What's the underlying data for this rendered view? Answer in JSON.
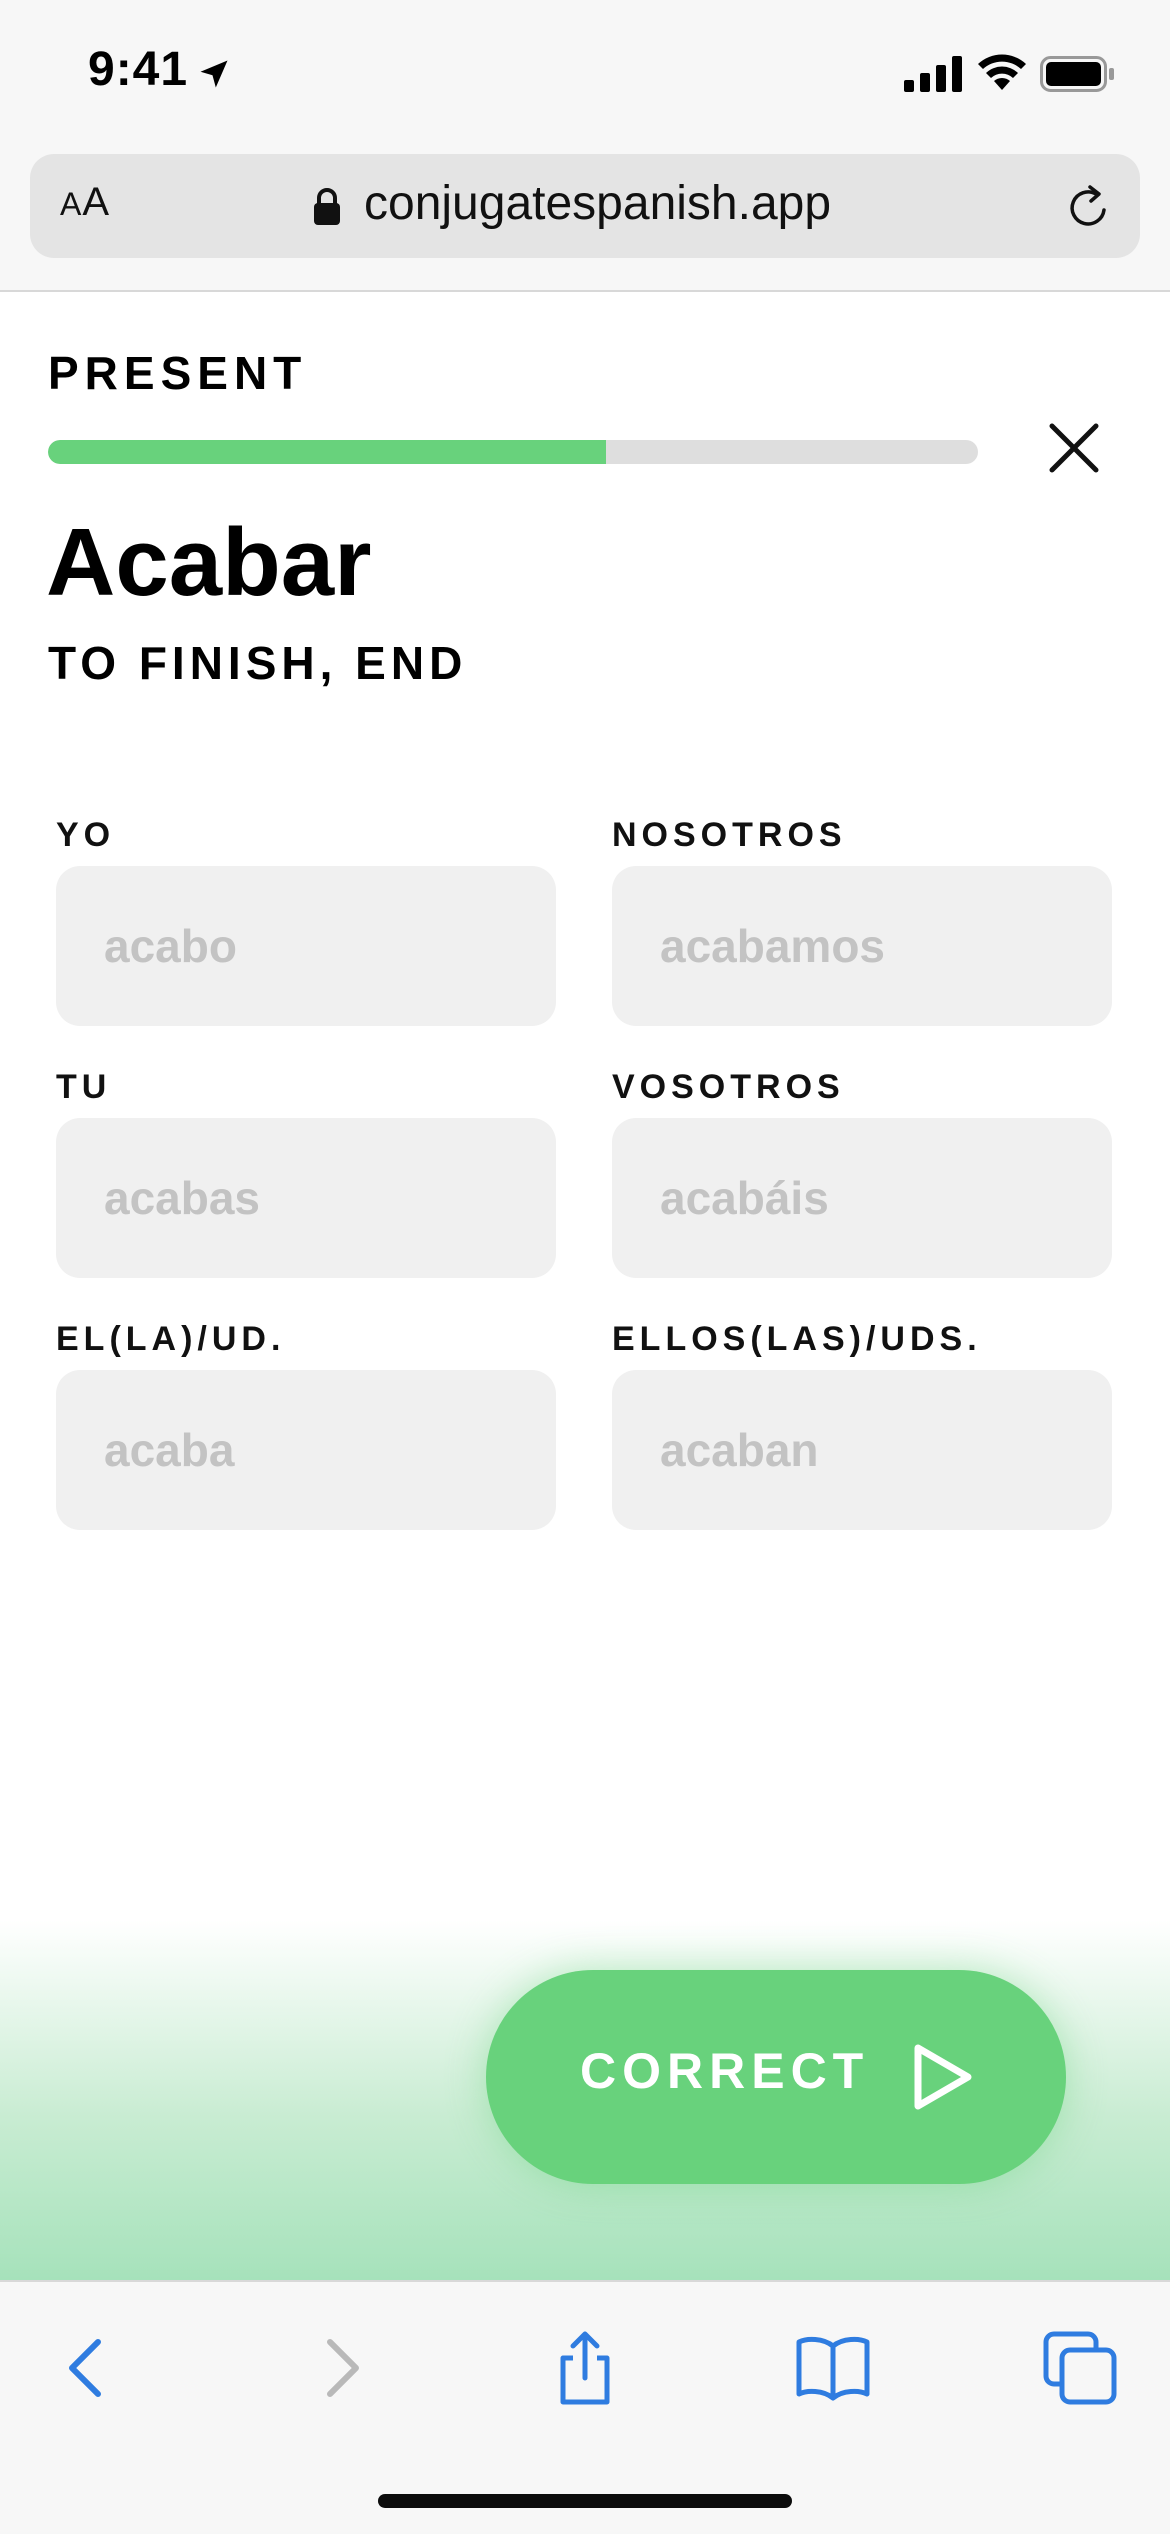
{
  "status_bar": {
    "time": "9:41"
  },
  "browser": {
    "text_size_label_small": "A",
    "text_size_label_large": "A",
    "url": "conjugatespanish.app"
  },
  "lesson": {
    "tense": "PRESENT",
    "progress_fraction": 0.6,
    "verb": "Acabar",
    "meaning": "TO FINISH, END"
  },
  "conjugations": [
    {
      "pronoun": "YO",
      "placeholder": "acabo"
    },
    {
      "pronoun": "NOSOTROS",
      "placeholder": "acabamos"
    },
    {
      "pronoun": "TU",
      "placeholder": "acabas"
    },
    {
      "pronoun": "VOSOTROS",
      "placeholder": "acabáis"
    },
    {
      "pronoun": "EL(LA)/UD.",
      "placeholder": "acaba"
    },
    {
      "pronoun": "ELLOS(LAS)/UDS.",
      "placeholder": "acaban"
    }
  ],
  "action": {
    "label": "CORRECT"
  },
  "colors": {
    "accent_green": "#68d27c",
    "toolbar_blue": "#2f7ce0",
    "disabled_gray": "#b9b9b9"
  },
  "icons": {
    "location": "location-arrow-icon",
    "lock": "lock-icon",
    "reload": "reload-icon",
    "close": "close-icon",
    "play": "play-icon",
    "back": "chevron-left-icon",
    "forward": "chevron-right-icon",
    "share": "share-icon",
    "bookmarks": "book-icon",
    "tabs": "tabs-icon"
  }
}
